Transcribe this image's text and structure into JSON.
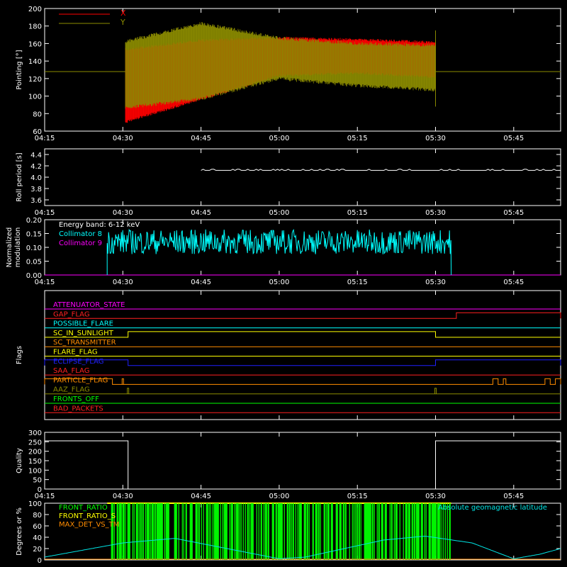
{
  "time_ticks": [
    "04:15",
    "04:30",
    "04:45",
    "05:00",
    "05:15",
    "05:30",
    "05:45"
  ],
  "chart_data": [
    {
      "type": "line",
      "ylabel": "Pointing [°]",
      "ylim": [
        60,
        200
      ],
      "y_ticks": [
        "60",
        "80",
        "100",
        "120",
        "140",
        "160",
        "180",
        "200"
      ],
      "series": [
        {
          "name": "X",
          "color": "#ff0000",
          "envelope": {
            "t": [
              "04:30",
              "04:31",
              "04:45",
              "05:00",
              "05:15",
              "05:30"
            ],
            "upper": [
              155,
              155,
              165,
              168,
              166,
              163
            ],
            "lower": [
              65,
              70,
              95,
              122,
              125,
              120
            ]
          }
        },
        {
          "name": "Y",
          "color": "#8b8b00",
          "envelope": {
            "t": [
              "04:30",
              "04:31",
              "04:45",
              "05:00",
              "05:15",
              "05:30"
            ],
            "upper": [
              160,
              165,
              185,
              168,
              162,
              160
            ],
            "lower": [
              85,
              85,
              95,
              118,
              110,
              105
            ]
          },
          "baseline": 128
        }
      ]
    },
    {
      "type": "line",
      "ylabel": "Roll period [s]",
      "ylim": [
        3.5,
        4.5
      ],
      "y_ticks": [
        "3.6",
        "3.8",
        "4.0",
        "4.2",
        "4.4"
      ],
      "series": [
        {
          "name": "",
          "color": "#ffffff",
          "t_range": [
            "04:45",
            "05:54"
          ],
          "value": 4.12
        }
      ]
    },
    {
      "type": "line",
      "ylabel": "Normalized modulation",
      "ylabel_lines": [
        "Normalized",
        "modulation"
      ],
      "ylim": [
        0,
        0.2
      ],
      "y_ticks": [
        "0.00",
        "0.05",
        "0.10",
        "0.15",
        "0.20"
      ],
      "annotation": "Energy band: 6-12 keV",
      "series": [
        {
          "name": "Collimator 8",
          "color": "#00ffff",
          "t_range": [
            "04:27",
            "05:33"
          ],
          "mean": 0.12,
          "spread": 0.045
        },
        {
          "name": "Collimator 9",
          "color": "#ff00ff",
          "value": 0.0
        }
      ]
    },
    {
      "type": "line",
      "ylabel": "Flags",
      "flags": [
        {
          "name": "ATTENUATOR_STATE",
          "color": "#ff00ff"
        },
        {
          "name": "GAP_FLAG",
          "color": "#ff2020",
          "high_ranges": [
            [
              "05:34",
              "05:54"
            ]
          ]
        },
        {
          "name": "POSSIBLE_FLARE",
          "color": "#00ffff"
        },
        {
          "name": "SC_IN_SUNLIGHT",
          "color": "#ffff00",
          "high_ranges": [
            [
              "04:31",
              "05:30"
            ]
          ]
        },
        {
          "name": "SC_TRANSMITTER",
          "color": "#ff8c00"
        },
        {
          "name": "FLARE_FLAG",
          "color": "#ffff00"
        },
        {
          "name": "ECLIPSE_FLAG",
          "color": "#2020ff",
          "high_ranges": [
            [
              "04:15",
              "04:31"
            ],
            [
              "05:30",
              "05:54"
            ]
          ]
        },
        {
          "name": "SAA_FLAG",
          "color": "#ff2020"
        },
        {
          "name": "PARTICLE_FLAG",
          "color": "#ff8c00",
          "high_ranges": [
            [
              "04:15",
              "04:28"
            ],
            [
              "05:41",
              "05:42"
            ],
            [
              "05:43",
              "05:43.5"
            ],
            [
              "05:51",
              "05:52"
            ],
            [
              "05:53",
              "05:54"
            ]
          ],
          "spikes": [
            "04:30"
          ]
        },
        {
          "name": "AAZ_FLAG",
          "color": "#8b8b00",
          "spikes": [
            "04:31",
            "05:30"
          ]
        },
        {
          "name": "FRONTS_OFF",
          "color": "#00ff00"
        },
        {
          "name": "BAD_PACKETS",
          "color": "#ff2020"
        }
      ]
    },
    {
      "type": "line",
      "ylabel": "Quality",
      "ylim": [
        0,
        300
      ],
      "y_ticks": [
        "0",
        "50",
        "100",
        "150",
        "200",
        "250",
        "300"
      ],
      "series": [
        {
          "name": "",
          "color": "#ffffff",
          "segments": [
            {
              "t": [
                "04:15",
                "04:31"
              ],
              "value": 255
            },
            {
              "t": [
                "04:31",
                "05:30"
              ],
              "value": 0
            },
            {
              "t": [
                "05:30",
                "05:54"
              ],
              "value": 255
            }
          ]
        }
      ]
    },
    {
      "type": "area",
      "ylabel": "Degrees or %",
      "ylim": [
        0,
        100
      ],
      "y_ticks": [
        "0",
        "20",
        "40",
        "60",
        "80",
        "100"
      ],
      "legend": [
        "FRONT_RATIO",
        "FRONT_RATIO_S",
        "MAX_DET_VS_TM"
      ],
      "annotation": "Absolute geomagnetic latitude",
      "series": [
        {
          "name": "FRONT_RATIO",
          "color": "#00ff00",
          "t_range": [
            "04:27",
            "05:33"
          ],
          "value": 100
        },
        {
          "name": "FRONT_RATIO_S",
          "color": "#ffff00",
          "t_range": [
            "04:27",
            "05:33"
          ],
          "value": 100
        },
        {
          "name": "MAX_DET_VS_TM",
          "color": "#ff8c00",
          "value": 0
        },
        {
          "name": "Absolute geomagnetic latitude",
          "color": "#00e5e5",
          "t": [
            "04:15",
            "04:30",
            "04:40",
            "05:00",
            "05:05",
            "05:20",
            "05:28",
            "05:37",
            "05:45",
            "05:50",
            "05:54"
          ],
          "values": [
            5,
            30,
            38,
            2,
            5,
            35,
            42,
            30,
            2,
            10,
            20
          ]
        }
      ]
    }
  ]
}
